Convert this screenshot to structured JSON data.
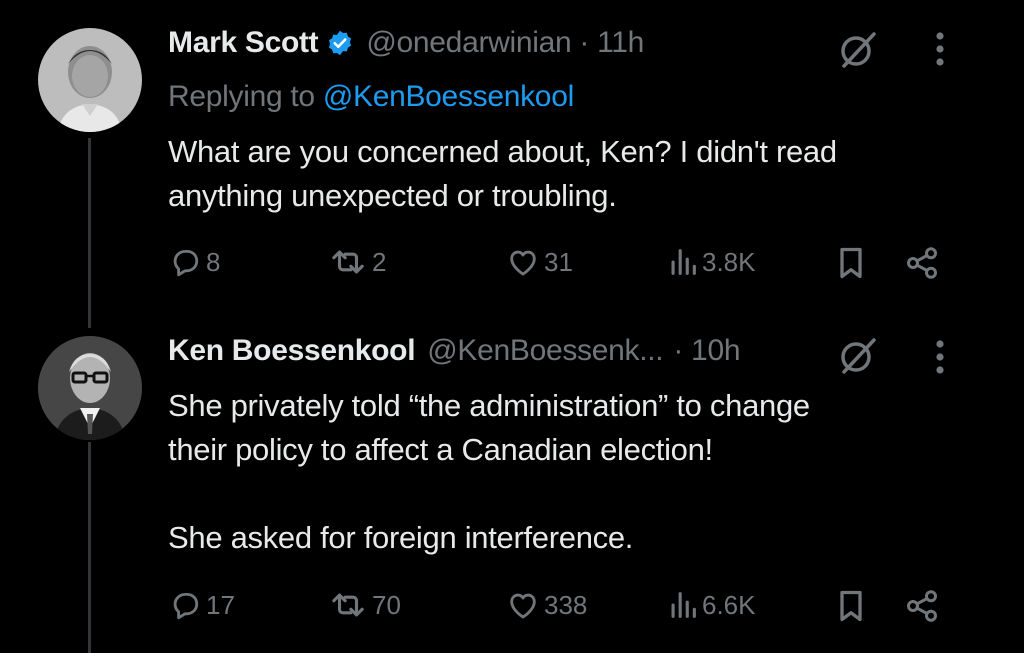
{
  "tweets": [
    {
      "name": "Mark Scott",
      "verified": true,
      "handle": "@onedarwinian",
      "time": "· 11h",
      "reply_prefix": "Replying to ",
      "reply_handle": "@KenBoessenkool",
      "text_lines": [
        "What are you concerned about, Ken? I didn't read",
        "anything unexpected or troubling."
      ],
      "replies": "8",
      "retweets": "2",
      "likes": "31",
      "views": "3.8K",
      "icons": [
        "reply-icon",
        "retweet-icon",
        "like-icon",
        "views-icon",
        "bookmark-icon",
        "share-icon",
        "grok-icon",
        "more-icon"
      ]
    },
    {
      "name": "Ken Boessenkool",
      "verified": false,
      "handle": "@KenBoessenk...",
      "time": "· 10h",
      "text_lines": [
        "She privately told “the administration” to change",
        "their policy to affect  a Canadian election!"
      ],
      "text_line_2": "She asked for foreign interference.",
      "replies": "17",
      "retweets": "70",
      "likes": "338",
      "views": "6.6K",
      "icons": [
        "reply-icon",
        "retweet-icon",
        "like-icon",
        "views-icon",
        "bookmark-icon",
        "share-icon",
        "grok-icon",
        "more-icon"
      ]
    }
  ],
  "colors": {
    "background": "#000000",
    "text": "#e7e9ea",
    "secondary": "#71767b",
    "link": "#1d9bf0",
    "verified": "#1d9bf0",
    "thread_line": "#333639"
  }
}
